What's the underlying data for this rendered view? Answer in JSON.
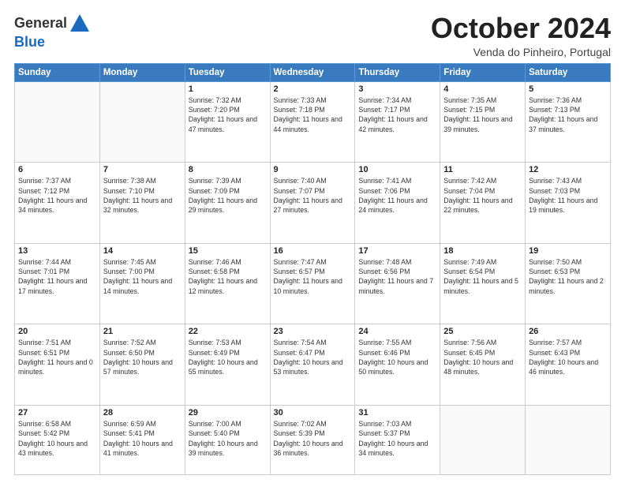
{
  "header": {
    "logo_general": "General",
    "logo_blue": "Blue",
    "month": "October 2024",
    "location": "Venda do Pinheiro, Portugal"
  },
  "days_of_week": [
    "Sunday",
    "Monday",
    "Tuesday",
    "Wednesday",
    "Thursday",
    "Friday",
    "Saturday"
  ],
  "weeks": [
    [
      {
        "day": "",
        "detail": ""
      },
      {
        "day": "",
        "detail": ""
      },
      {
        "day": "1",
        "detail": "Sunrise: 7:32 AM\nSunset: 7:20 PM\nDaylight: 11 hours and 47 minutes."
      },
      {
        "day": "2",
        "detail": "Sunrise: 7:33 AM\nSunset: 7:18 PM\nDaylight: 11 hours and 44 minutes."
      },
      {
        "day": "3",
        "detail": "Sunrise: 7:34 AM\nSunset: 7:17 PM\nDaylight: 11 hours and 42 minutes."
      },
      {
        "day": "4",
        "detail": "Sunrise: 7:35 AM\nSunset: 7:15 PM\nDaylight: 11 hours and 39 minutes."
      },
      {
        "day": "5",
        "detail": "Sunrise: 7:36 AM\nSunset: 7:13 PM\nDaylight: 11 hours and 37 minutes."
      }
    ],
    [
      {
        "day": "6",
        "detail": "Sunrise: 7:37 AM\nSunset: 7:12 PM\nDaylight: 11 hours and 34 minutes."
      },
      {
        "day": "7",
        "detail": "Sunrise: 7:38 AM\nSunset: 7:10 PM\nDaylight: 11 hours and 32 minutes."
      },
      {
        "day": "8",
        "detail": "Sunrise: 7:39 AM\nSunset: 7:09 PM\nDaylight: 11 hours and 29 minutes."
      },
      {
        "day": "9",
        "detail": "Sunrise: 7:40 AM\nSunset: 7:07 PM\nDaylight: 11 hours and 27 minutes."
      },
      {
        "day": "10",
        "detail": "Sunrise: 7:41 AM\nSunset: 7:06 PM\nDaylight: 11 hours and 24 minutes."
      },
      {
        "day": "11",
        "detail": "Sunrise: 7:42 AM\nSunset: 7:04 PM\nDaylight: 11 hours and 22 minutes."
      },
      {
        "day": "12",
        "detail": "Sunrise: 7:43 AM\nSunset: 7:03 PM\nDaylight: 11 hours and 19 minutes."
      }
    ],
    [
      {
        "day": "13",
        "detail": "Sunrise: 7:44 AM\nSunset: 7:01 PM\nDaylight: 11 hours and 17 minutes."
      },
      {
        "day": "14",
        "detail": "Sunrise: 7:45 AM\nSunset: 7:00 PM\nDaylight: 11 hours and 14 minutes."
      },
      {
        "day": "15",
        "detail": "Sunrise: 7:46 AM\nSunset: 6:58 PM\nDaylight: 11 hours and 12 minutes."
      },
      {
        "day": "16",
        "detail": "Sunrise: 7:47 AM\nSunset: 6:57 PM\nDaylight: 11 hours and 10 minutes."
      },
      {
        "day": "17",
        "detail": "Sunrise: 7:48 AM\nSunset: 6:56 PM\nDaylight: 11 hours and 7 minutes."
      },
      {
        "day": "18",
        "detail": "Sunrise: 7:49 AM\nSunset: 6:54 PM\nDaylight: 11 hours and 5 minutes."
      },
      {
        "day": "19",
        "detail": "Sunrise: 7:50 AM\nSunset: 6:53 PM\nDaylight: 11 hours and 2 minutes."
      }
    ],
    [
      {
        "day": "20",
        "detail": "Sunrise: 7:51 AM\nSunset: 6:51 PM\nDaylight: 11 hours and 0 minutes."
      },
      {
        "day": "21",
        "detail": "Sunrise: 7:52 AM\nSunset: 6:50 PM\nDaylight: 10 hours and 57 minutes."
      },
      {
        "day": "22",
        "detail": "Sunrise: 7:53 AM\nSunset: 6:49 PM\nDaylight: 10 hours and 55 minutes."
      },
      {
        "day": "23",
        "detail": "Sunrise: 7:54 AM\nSunset: 6:47 PM\nDaylight: 10 hours and 53 minutes."
      },
      {
        "day": "24",
        "detail": "Sunrise: 7:55 AM\nSunset: 6:46 PM\nDaylight: 10 hours and 50 minutes."
      },
      {
        "day": "25",
        "detail": "Sunrise: 7:56 AM\nSunset: 6:45 PM\nDaylight: 10 hours and 48 minutes."
      },
      {
        "day": "26",
        "detail": "Sunrise: 7:57 AM\nSunset: 6:43 PM\nDaylight: 10 hours and 46 minutes."
      }
    ],
    [
      {
        "day": "27",
        "detail": "Sunrise: 6:58 AM\nSunset: 5:42 PM\nDaylight: 10 hours and 43 minutes."
      },
      {
        "day": "28",
        "detail": "Sunrise: 6:59 AM\nSunset: 5:41 PM\nDaylight: 10 hours and 41 minutes."
      },
      {
        "day": "29",
        "detail": "Sunrise: 7:00 AM\nSunset: 5:40 PM\nDaylight: 10 hours and 39 minutes."
      },
      {
        "day": "30",
        "detail": "Sunrise: 7:02 AM\nSunset: 5:39 PM\nDaylight: 10 hours and 36 minutes."
      },
      {
        "day": "31",
        "detail": "Sunrise: 7:03 AM\nSunset: 5:37 PM\nDaylight: 10 hours and 34 minutes."
      },
      {
        "day": "",
        "detail": ""
      },
      {
        "day": "",
        "detail": ""
      }
    ]
  ]
}
